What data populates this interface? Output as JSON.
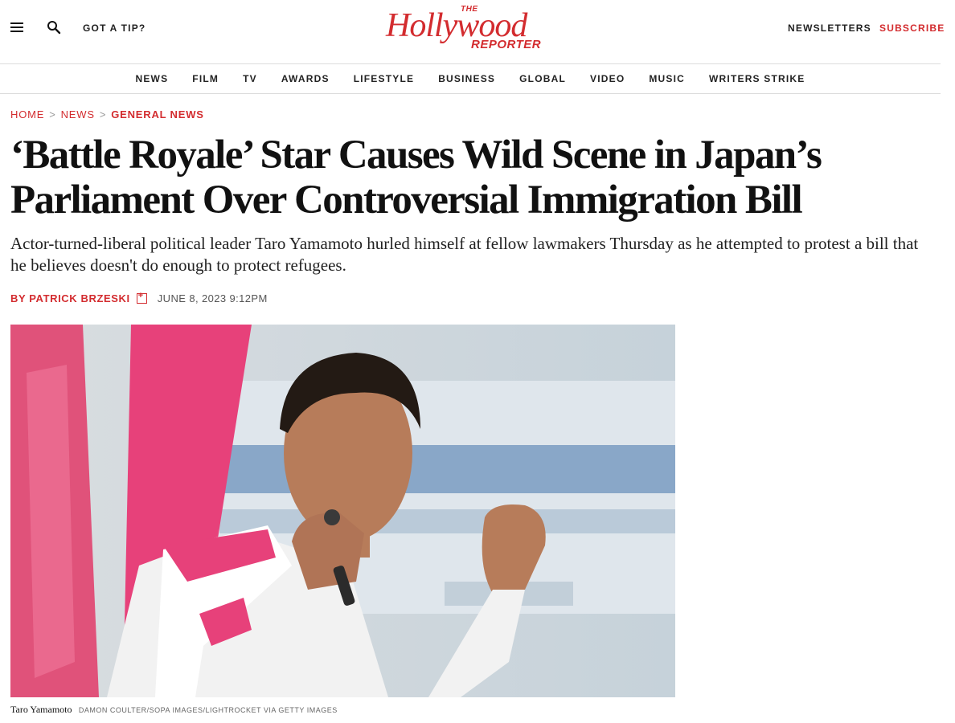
{
  "header": {
    "tip_label": "GOT A TIP?",
    "logo_the": "THE",
    "logo_main": "Hollywood",
    "logo_reporter": "REPORTER",
    "newsletters_label": "NEWSLETTERS",
    "subscribe_label": "SUBSCRIBE",
    "brand_color": "#d32c2f"
  },
  "nav": {
    "items": [
      "NEWS",
      "FILM",
      "TV",
      "AWARDS",
      "LIFESTYLE",
      "BUSINESS",
      "GLOBAL",
      "VIDEO",
      "MUSIC",
      "WRITERS STRIKE"
    ]
  },
  "breadcrumb": {
    "home": "HOME",
    "news": "NEWS",
    "current": "GENERAL NEWS",
    "separator": ">"
  },
  "article": {
    "headline": "‘Battle Royale’ Star Causes Wild Scene in Japan’s Parliament Over Controversial Immigration Bill",
    "dek": "Actor-turned-liberal political leader Taro Yamamoto hurled himself at fellow lawmakers Thursday as he attempted to protest a bill that he believes doesn't do enough to protect refugees.",
    "author": "BY PATRICK BRZESKI",
    "date": "JUNE 8, 2023 9:12PM",
    "photo_caption": "Taro Yamamoto",
    "photo_credit": "DAMON COULTER/SOPA IMAGES/LIGHTROCKET VIA GETTY IMAGES"
  },
  "icons": {
    "menu": "hamburger-menu-icon",
    "search": "search-icon",
    "author_follow": "author-follow-icon"
  }
}
